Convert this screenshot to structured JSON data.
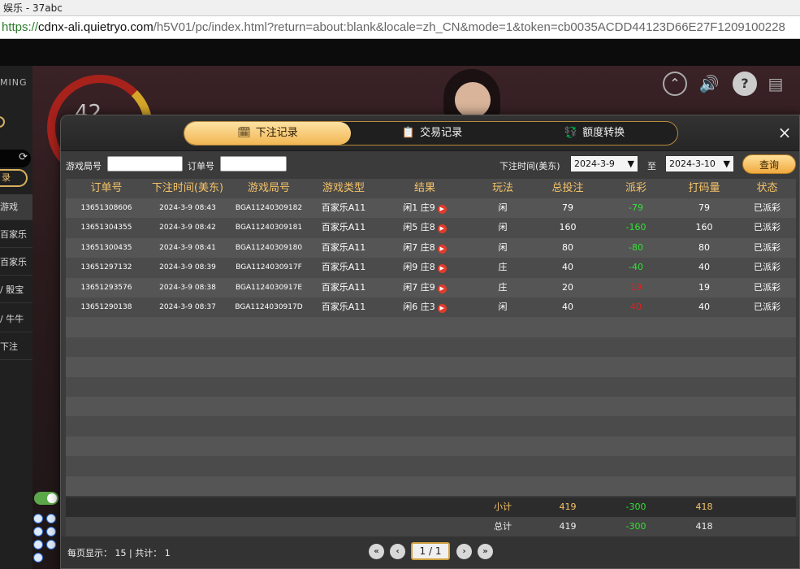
{
  "browser": {
    "title": "娱乐 - 37abc",
    "url_scheme": "https://",
    "url_host": "cdnx-ali.quietryo.com",
    "url_path": "/h5V01/pc/index.html?return=about:blank&locale=zh_CN&mode=1&token=cb0035ACDD44123D66E27F1209100228"
  },
  "game": {
    "logo_text": "MING",
    "timer_value": "42",
    "sidebar_items": [
      "录",
      "游戏",
      "百家乐",
      "百家乐",
      "/ 骰宝",
      "/ 牛牛",
      "下注"
    ],
    "colors": {
      "accent": "#f2b653",
      "win": "#36e036",
      "lose": "#e02020"
    }
  },
  "modal": {
    "tabs": [
      {
        "label": "下注记录",
        "icon": "clipboard-icon",
        "active": true
      },
      {
        "label": "交易记录",
        "icon": "document-icon",
        "active": false
      },
      {
        "label": "额度转换",
        "icon": "wallet-icon",
        "active": false
      }
    ],
    "close_label": "×",
    "filter": {
      "game_round_label": "游戏局号",
      "game_round_value": "",
      "order_label": "订单号",
      "order_value": "",
      "time_label": "下注时间(美东)",
      "start_date": "2024-3-9",
      "to_label": "至",
      "end_date": "2024-3-10",
      "query_label": "查询"
    },
    "columns": [
      "订单号",
      "下注时间(美东)",
      "游戏局号",
      "游戏类型",
      "结果",
      "玩法",
      "总投注",
      "派彩",
      "打码量",
      "状态"
    ],
    "rows": [
      {
        "order": "13651308606",
        "time": "2024-3-9 08:43",
        "round": "BGA11240309182",
        "type": "百家乐A11",
        "result": "闲1 庄9",
        "bet_on": "闲",
        "total": "79",
        "payout": "-79",
        "payout_color": "win",
        "turnover": "79",
        "status": "已派彩"
      },
      {
        "order": "13651304355",
        "time": "2024-3-9 08:42",
        "round": "BGA11240309181",
        "type": "百家乐A11",
        "result": "闲5 庄8",
        "bet_on": "闲",
        "total": "160",
        "payout": "-160",
        "payout_color": "win",
        "turnover": "160",
        "status": "已派彩"
      },
      {
        "order": "13651300435",
        "time": "2024-3-9 08:41",
        "round": "BGA11240309180",
        "type": "百家乐A11",
        "result": "闲7 庄8",
        "bet_on": "闲",
        "total": "80",
        "payout": "-80",
        "payout_color": "win",
        "turnover": "80",
        "status": "已派彩"
      },
      {
        "order": "13651297132",
        "time": "2024-3-9 08:39",
        "round": "BGA1124030917F",
        "type": "百家乐A11",
        "result": "闲9 庄8",
        "bet_on": "庄",
        "total": "40",
        "payout": "-40",
        "payout_color": "win",
        "turnover": "40",
        "status": "已派彩"
      },
      {
        "order": "13651293576",
        "time": "2024-3-9 08:38",
        "round": "BGA1124030917E",
        "type": "百家乐A11",
        "result": "闲7 庄9",
        "bet_on": "庄",
        "total": "20",
        "payout": "19",
        "payout_color": "lose",
        "turnover": "19",
        "status": "已派彩"
      },
      {
        "order": "13651290138",
        "time": "2024-3-9 08:37",
        "round": "BGA1124030917D",
        "type": "百家乐A11",
        "result": "闲6 庄3",
        "bet_on": "闲",
        "total": "40",
        "payout": "40",
        "payout_color": "lose",
        "turnover": "40",
        "status": "已派彩"
      }
    ],
    "subtotal": {
      "label": "小计",
      "total": "419",
      "payout": "-300",
      "turnover": "418"
    },
    "grandtotal": {
      "label": "总计",
      "total": "419",
      "payout": "-300",
      "turnover": "418"
    },
    "footer": {
      "per_page_label": "每页显示：",
      "per_page": "15",
      "separator": "|",
      "count_label": "共计：",
      "count": "1",
      "page_display": "1 / 1",
      "first_label": "«",
      "prev_label": "‹",
      "next_label": "›",
      "last_label": "»"
    }
  }
}
